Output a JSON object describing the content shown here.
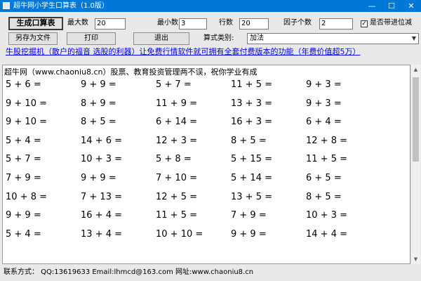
{
  "window": {
    "title": "超牛网小学生口算表（1.0版）",
    "minimize": "—",
    "maximize": "☐",
    "close": "✕"
  },
  "toolbar": {
    "generate_label": "生成口算表",
    "max_label": "最大数",
    "max_value": "20",
    "min_label": "最小数",
    "min_value": "3",
    "rows_label": "行数",
    "rows_value": "20",
    "factor_label": "因子个数",
    "factor_value": "2",
    "carry_label": "是否带进位减",
    "carry_checked": true,
    "save_label": "另存为文件",
    "print_label": "打印",
    "exit_label": "退出",
    "type_label": "算式类别:",
    "type_value": "加法"
  },
  "promo": "牛股挖掘机（散户的福音 选股的利器）让免费行情软件就可拥有全套付费版本的功能（年费价值超5万）",
  "content": {
    "header": "超牛网（www.chaoniu8.cn）股票、教育投资管理两不误，祝你学业有成",
    "rows": [
      [
        "5 + 6 =",
        "9 + 9 =",
        "5 + 7 =",
        "11 + 5 =",
        "9 + 3 ="
      ],
      [
        "9 + 10 =",
        "8 + 9 =",
        "11 + 9 =",
        "13 + 3 =",
        "9 + 3 ="
      ],
      [
        "9 + 10 =",
        "8 + 5 =",
        "6 + 14 =",
        "16 + 3 =",
        "6 + 4 ="
      ],
      [
        "5 + 4 =",
        "14 + 6 =",
        "12 + 3 =",
        "8 + 5 =",
        "12 + 8 ="
      ],
      [
        "5 + 7 =",
        "10 + 3 =",
        "5 + 8 =",
        "5 + 15 =",
        "11 + 5 ="
      ],
      [
        "7 + 9 =",
        "9 + 9 =",
        "7 + 10 =",
        "5 + 14 =",
        "6 + 5 ="
      ],
      [
        "10 + 8 =",
        "7 + 13 =",
        "12 + 5 =",
        "13 + 5 =",
        "8 + 5 ="
      ],
      [
        "9 + 9 =",
        "16 + 4 =",
        "11 + 5 =",
        "7 + 9 =",
        "10 + 3 ="
      ],
      [
        "5 + 4 =",
        "13 + 4 =",
        "10 + 10 =",
        "9 + 9 =",
        "14 + 4 ="
      ]
    ]
  },
  "footer": "联系方式：  QQ:13619633  Email:lhmcd@163.com  网址:www.chaoniu8.cn"
}
